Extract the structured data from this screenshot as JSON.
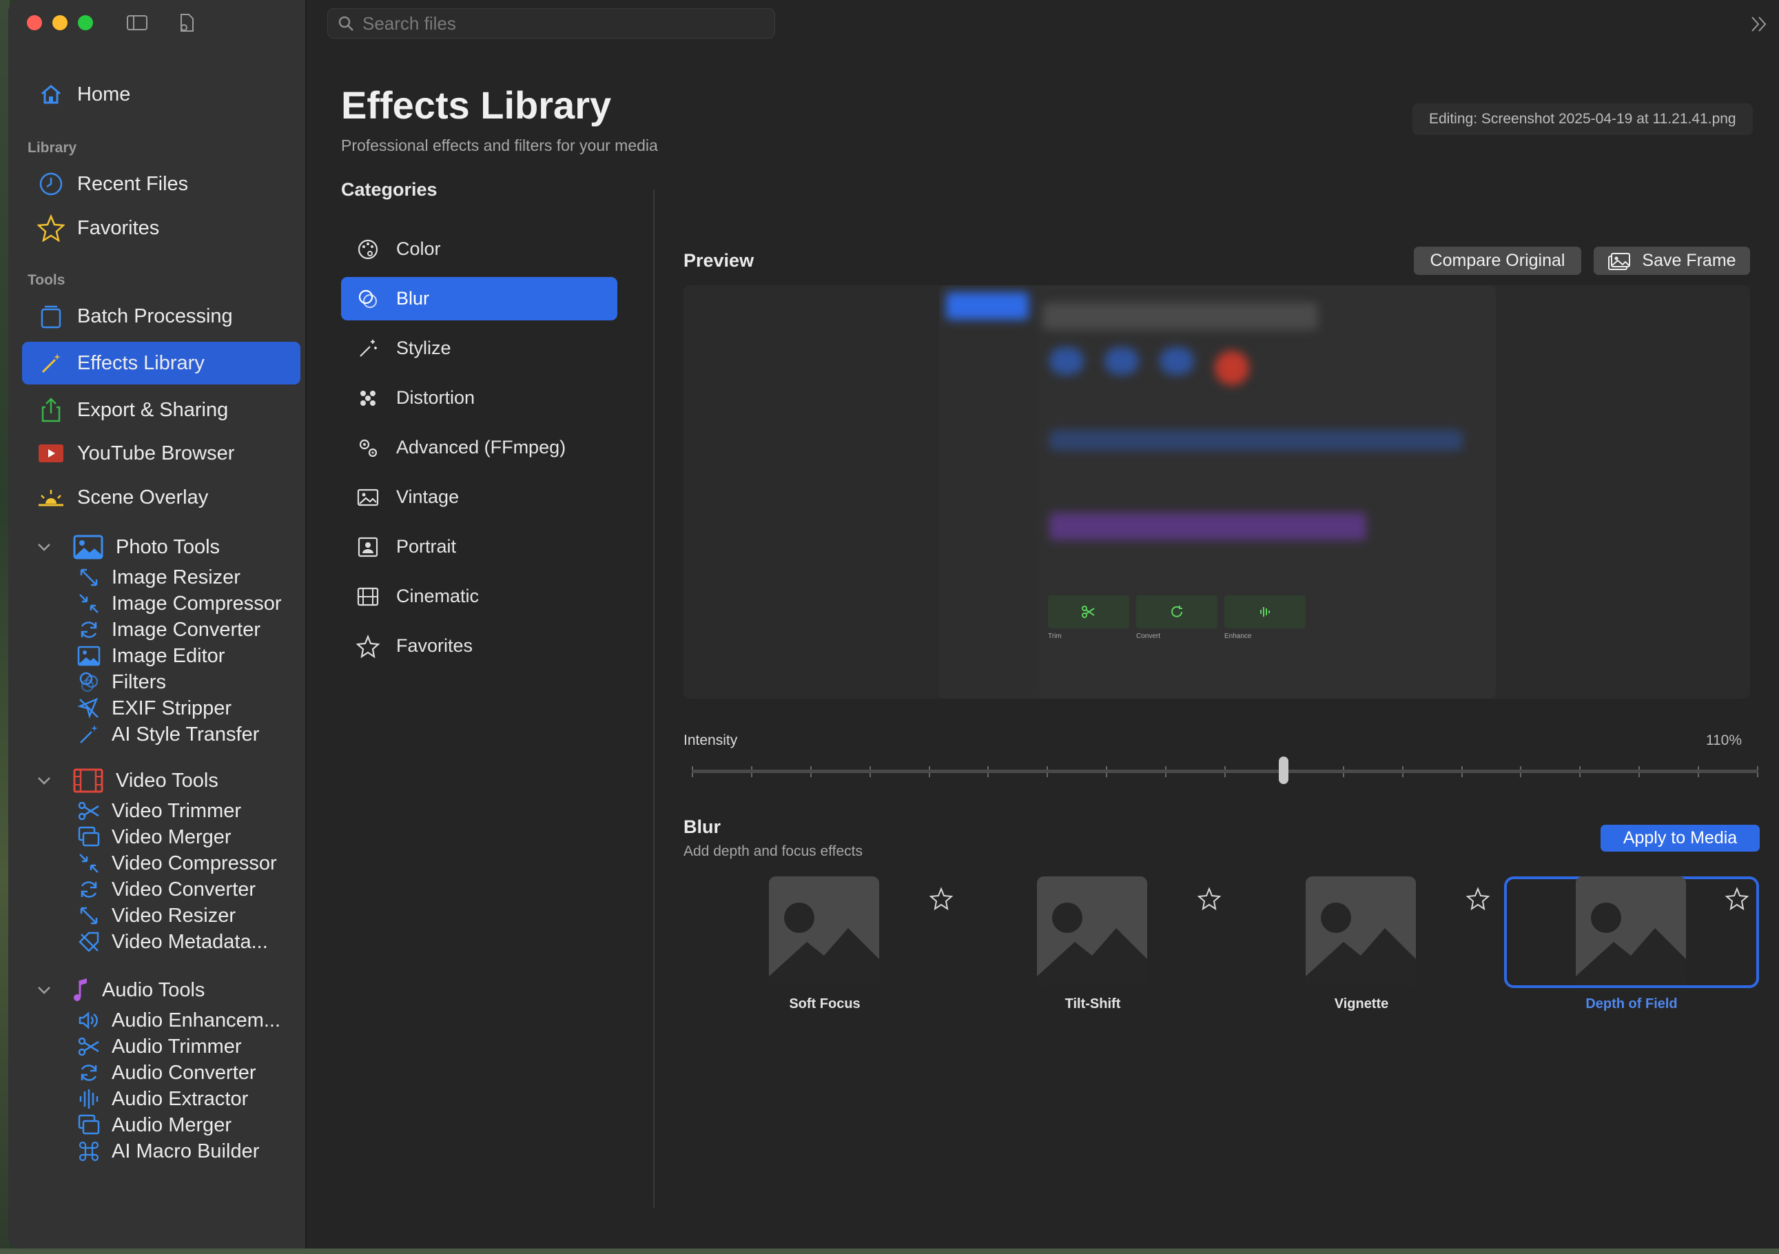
{
  "search": {
    "placeholder": "Search files"
  },
  "sidebar": {
    "home": "Home",
    "library_label": "Library",
    "library": [
      "Recent Files",
      "Favorites"
    ],
    "tools_label": "Tools",
    "tools": [
      "Batch Processing",
      "Effects Library",
      "Export & Sharing",
      "YouTube Browser",
      "Scene Overlay"
    ],
    "photo_tools": {
      "label": "Photo Tools",
      "items": [
        "Image Resizer",
        "Image Compressor",
        "Image Converter",
        "Image Editor",
        "Filters",
        "EXIF Stripper",
        "AI Style Transfer"
      ]
    },
    "video_tools": {
      "label": "Video Tools",
      "items": [
        "Video Trimmer",
        "Video Merger",
        "Video Compressor",
        "Video Converter",
        "Video Resizer",
        "Video Metadata..."
      ]
    },
    "audio_tools": {
      "label": "Audio Tools",
      "items": [
        "Audio Enhancem...",
        "Audio Trimmer",
        "Audio Converter",
        "Audio Extractor",
        "Audio Merger",
        "AI Macro Builder"
      ]
    }
  },
  "header": {
    "title": "Effects Library",
    "subtitle": "Professional effects and filters for your media",
    "editing": "Editing: Screenshot 2025-04-19 at 11.21.41.png"
  },
  "categories": {
    "title": "Categories",
    "items": [
      "Color",
      "Blur",
      "Stylize",
      "Distortion",
      "Advanced (FFmpeg)",
      "Vintage",
      "Portrait",
      "Cinematic",
      "Favorites"
    ],
    "selected": "Blur"
  },
  "preview": {
    "label": "Preview",
    "compare_label": "Compare Original",
    "save_frame_label": "Save Frame",
    "thumb_labels": [
      "Trim",
      "Convert",
      "Enhance"
    ]
  },
  "intensity": {
    "label": "Intensity",
    "value_text": "110%",
    "value_fraction": 0.555
  },
  "effects": {
    "title": "Blur",
    "subtitle": "Add depth and focus effects",
    "apply_label": "Apply to Media",
    "items": [
      "Soft Focus",
      "Tilt-Shift",
      "Vignette",
      "Depth of Field"
    ],
    "selected": "Depth of Field"
  },
  "colors": {
    "accent": "#2f6ae6",
    "sidebar_bg": "#333333",
    "main_bg": "#252525"
  }
}
